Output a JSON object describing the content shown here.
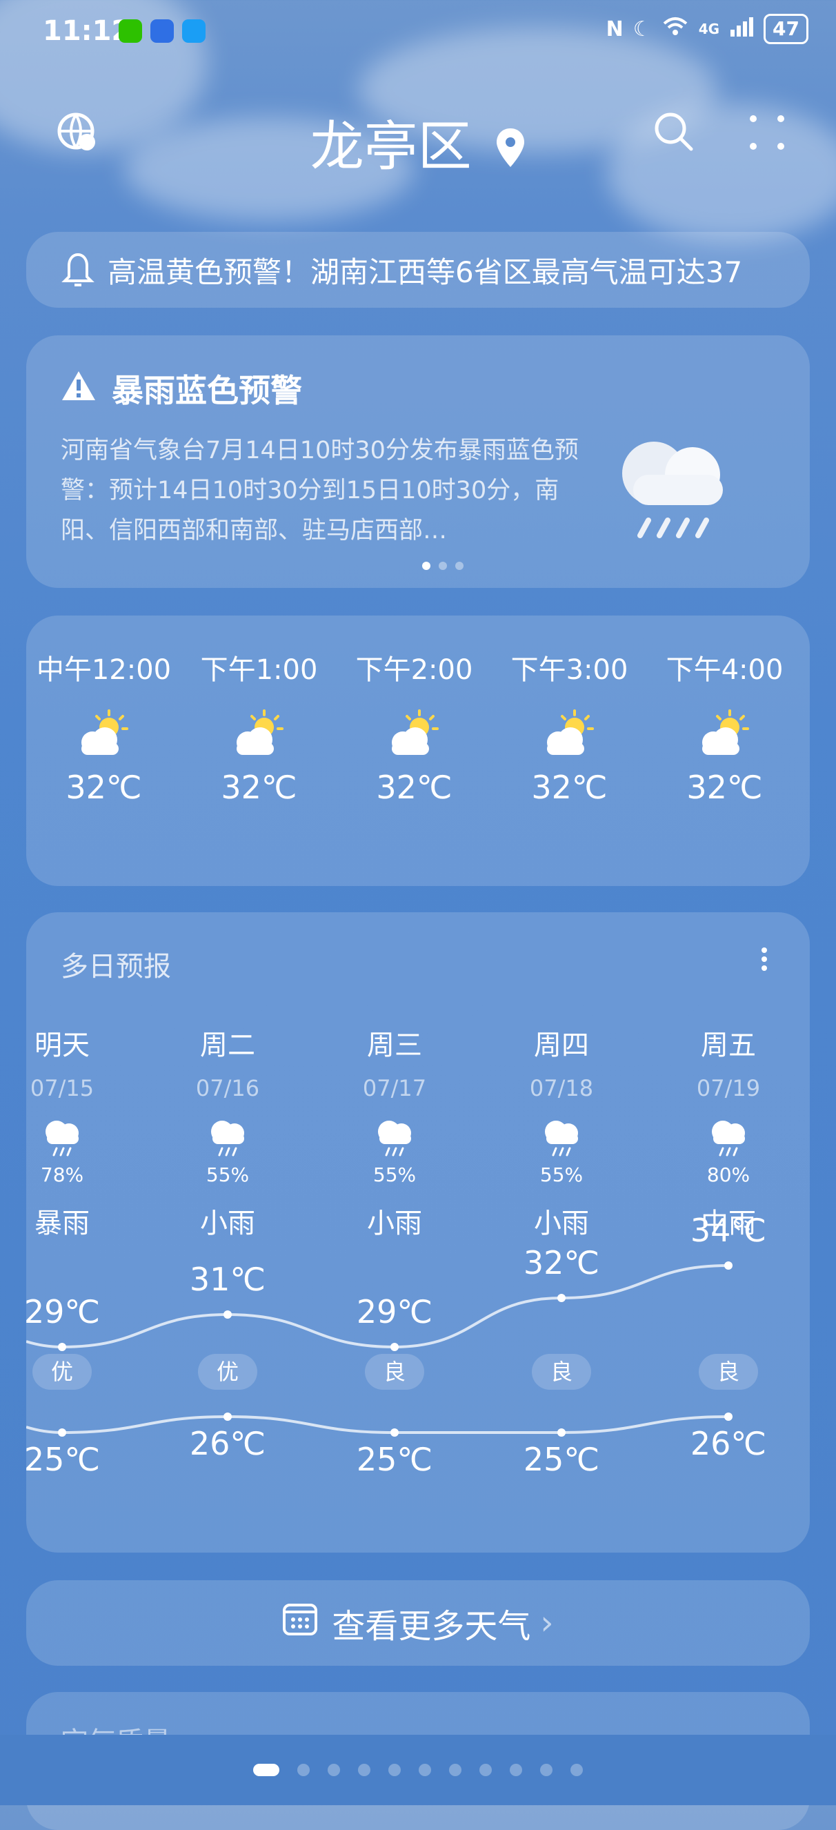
{
  "status": {
    "time": "11:12",
    "network": "4G",
    "battery": "47"
  },
  "header": {
    "city": "龙亭区"
  },
  "alert_ticker": "高温黄色预警！湖南江西等6省区最高气温可达37",
  "warning": {
    "title": "暴雨蓝色预警",
    "text": "河南省气象台7月14日10时30分发布暴雨蓝色预警：预计14日10时30分到15日10时30分，南阳、信阳西部和南部、驻马店西部…"
  },
  "hourly": [
    {
      "time": "中午12:00",
      "temp": "32℃"
    },
    {
      "time": "下午1:00",
      "temp": "32℃"
    },
    {
      "time": "下午2:00",
      "temp": "32℃"
    },
    {
      "time": "下午3:00",
      "temp": "32℃"
    },
    {
      "time": "下午4:00",
      "temp": "32℃"
    }
  ],
  "daily": {
    "title": "多日预报",
    "days": [
      {
        "day": "明天",
        "date": "07/15",
        "pct": "78%",
        "weather": "暴雨",
        "high": "29℃",
        "low": "25℃",
        "aqi": "优"
      },
      {
        "day": "周二",
        "date": "07/16",
        "pct": "55%",
        "weather": "小雨",
        "high": "31℃",
        "low": "26℃",
        "aqi": "优"
      },
      {
        "day": "周三",
        "date": "07/17",
        "pct": "55%",
        "weather": "小雨",
        "high": "29℃",
        "low": "25℃",
        "aqi": "良"
      },
      {
        "day": "周四",
        "date": "07/18",
        "pct": "55%",
        "weather": "小雨",
        "high": "32℃",
        "low": "25℃",
        "aqi": "良"
      },
      {
        "day": "周五",
        "date": "07/19",
        "pct": "80%",
        "weather": "中雨",
        "high": "34℃",
        "low": "26℃",
        "aqi": "良"
      }
    ]
  },
  "more_button": "查看更多天气",
  "next_card": "空气质量",
  "pager": {
    "pages": 11,
    "active": 0
  }
}
